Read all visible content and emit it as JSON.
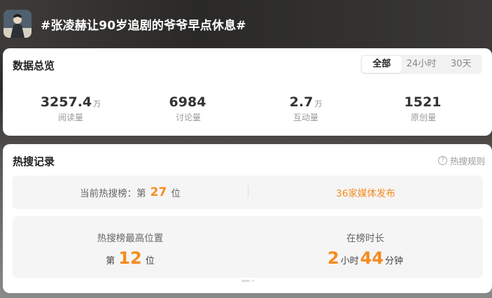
{
  "header": {
    "title": "#张凌赫让90岁追剧的爷爷早点休息#"
  },
  "overview": {
    "title": "数据总览",
    "tabs": [
      "全部",
      "24小时",
      "30天"
    ],
    "active_tab": "全部",
    "stats": [
      {
        "value": "3257.4",
        "unit": "万",
        "label": "阅读量"
      },
      {
        "value": "6984",
        "unit": "",
        "label": "讨论量"
      },
      {
        "value": "2.7",
        "unit": "万",
        "label": "互动量"
      },
      {
        "value": "1521",
        "unit": "",
        "label": "原创量"
      }
    ]
  },
  "hot_search": {
    "title": "热搜记录",
    "rules_label": "热搜规则",
    "current_rank": {
      "prefix": "当前热搜榜：第",
      "value": "27",
      "suffix": "位"
    },
    "media_label": "36家媒体发布",
    "highest": {
      "label": "热搜榜最高位置",
      "prefix": "第",
      "value": "12",
      "suffix": "位"
    },
    "duration": {
      "label": "在榜时长",
      "hours": "2",
      "hours_unit": "小时",
      "minutes": "44",
      "minutes_unit": "分钟"
    }
  },
  "colors": {
    "accent": "#f68b1f"
  }
}
